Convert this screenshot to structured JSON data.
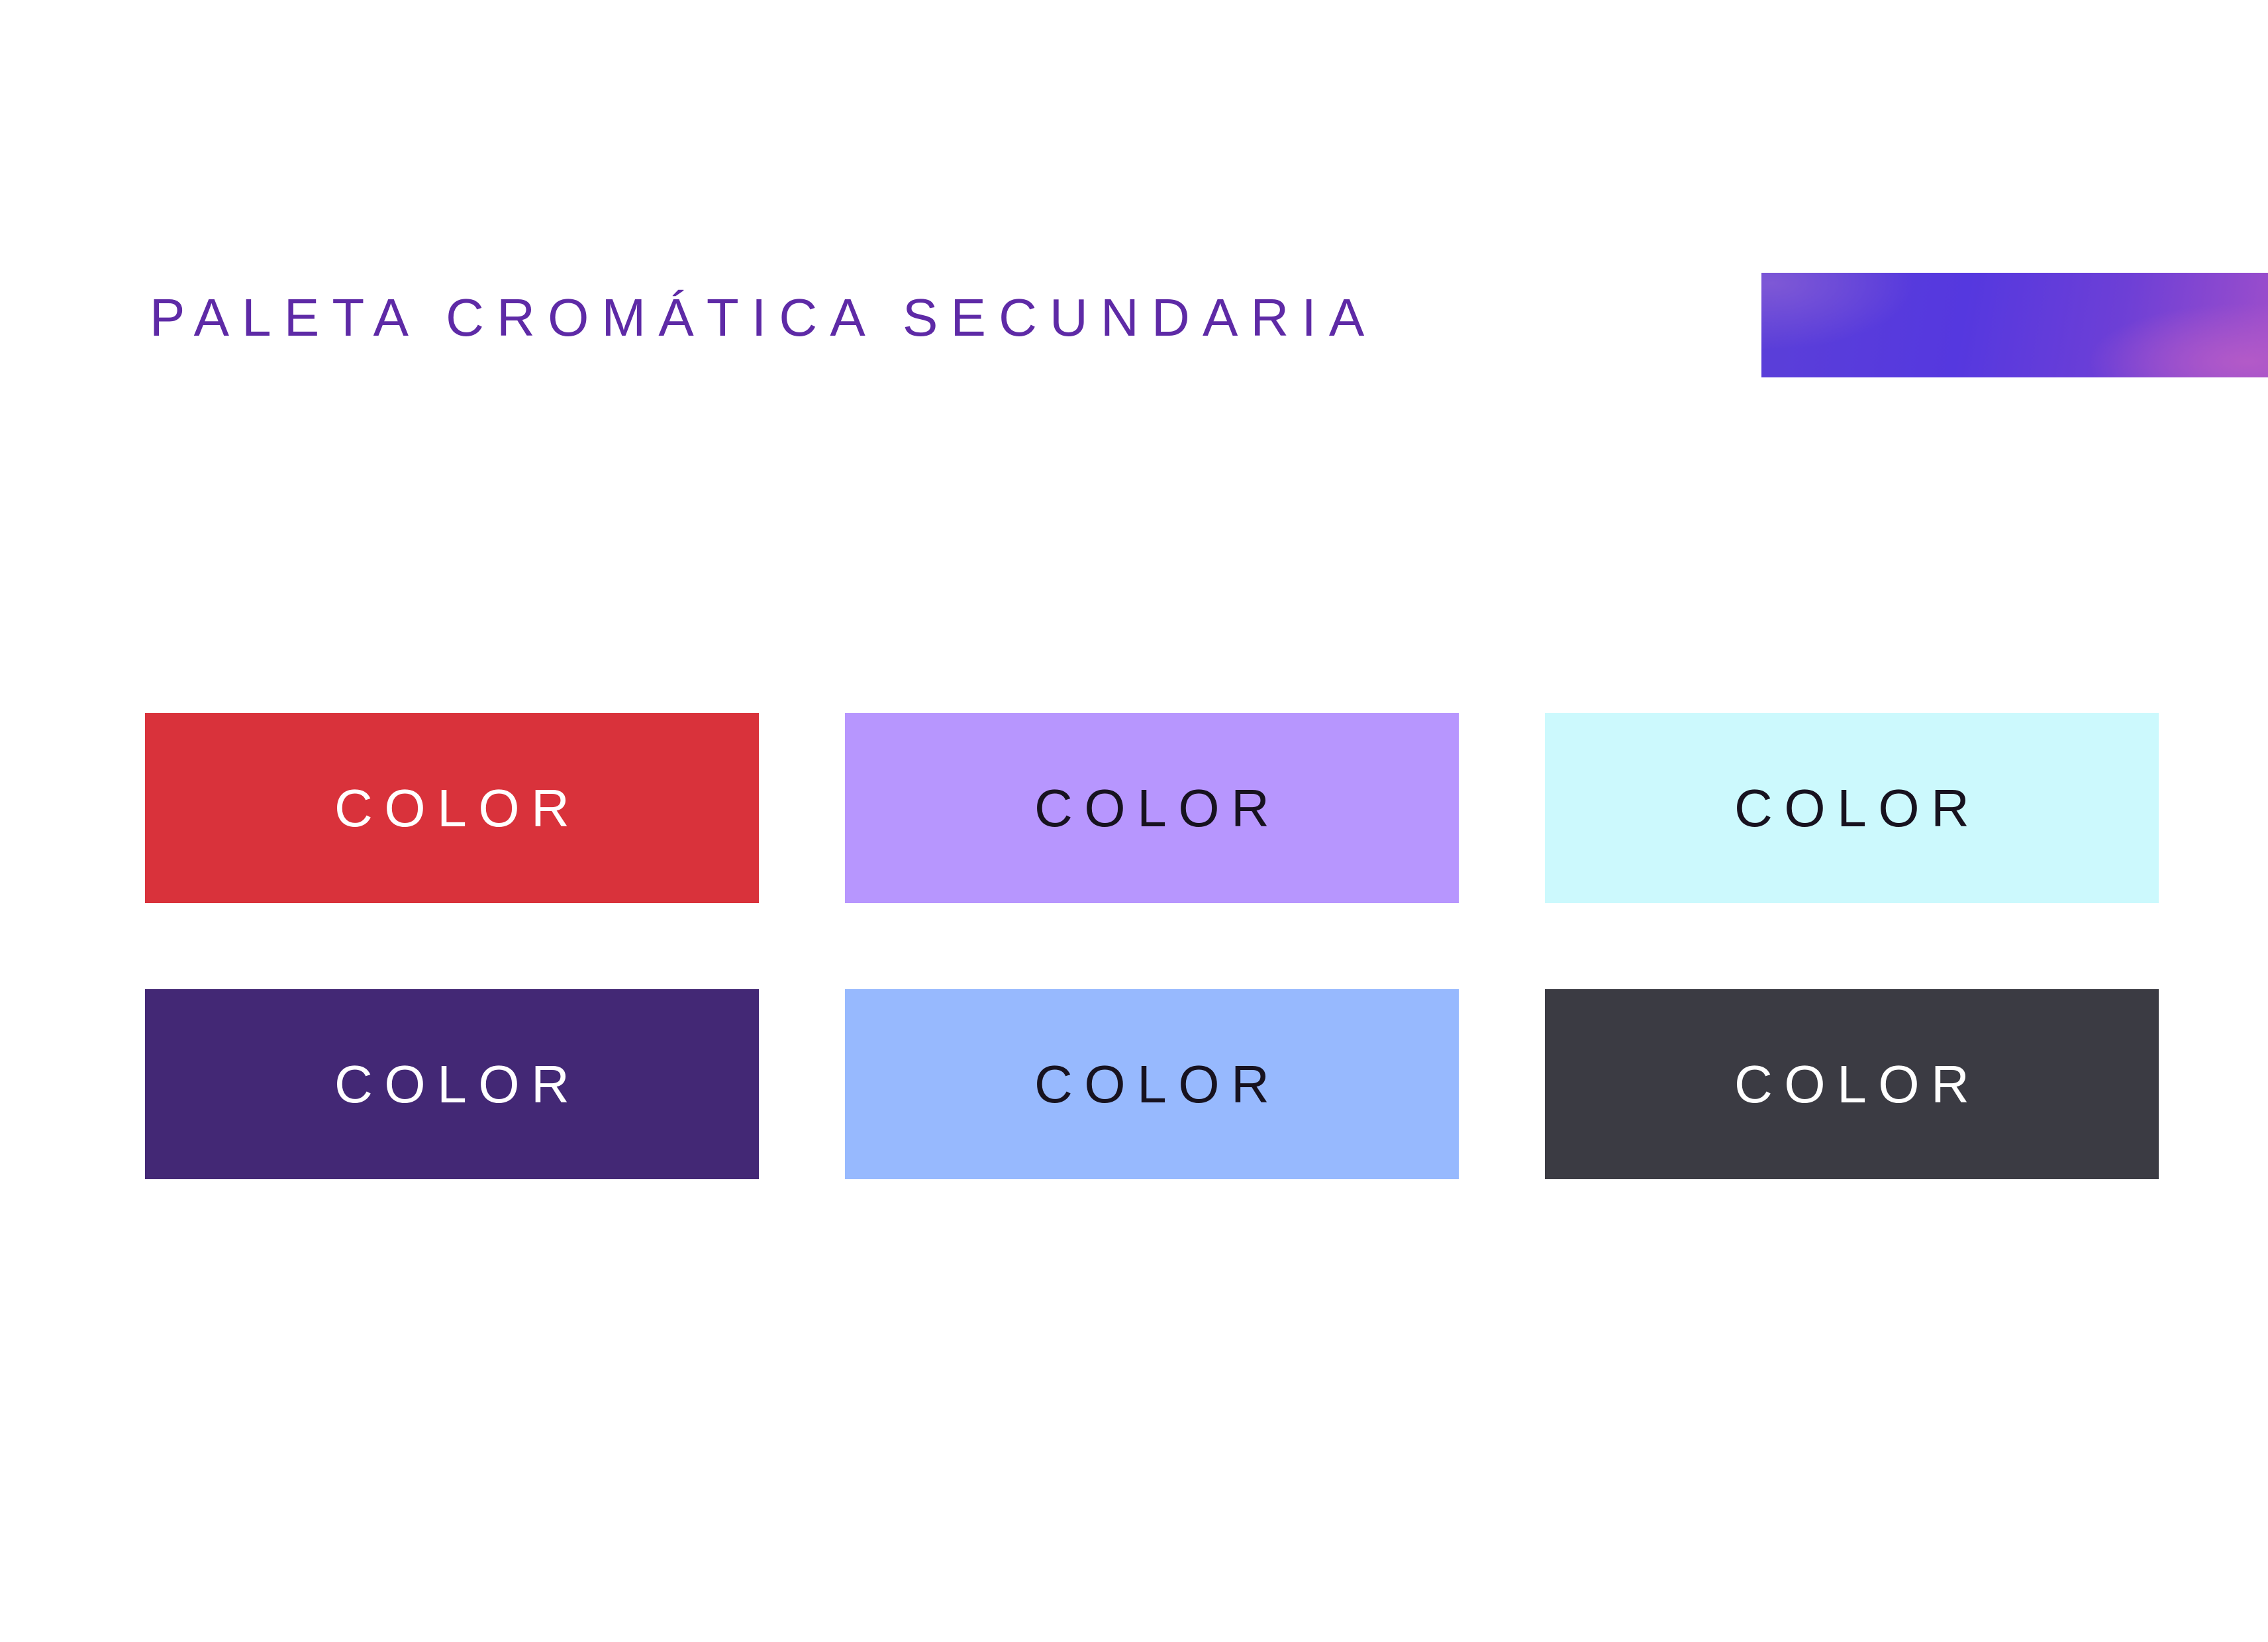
{
  "title": "PALETA CROMÁTICA SECUNDARIA",
  "title_color": "#5e2aa6",
  "accent_bar": {
    "colors": [
      "#5538df",
      "#b35ac8"
    ]
  },
  "swatches": [
    {
      "label": "COLOR",
      "color": "#d9323b",
      "text_color": "#ffffff"
    },
    {
      "label": "COLOR",
      "color": "#b796fe",
      "text_color": "#17121f"
    },
    {
      "label": "COLOR",
      "color": "#ccf9fd",
      "text_color": "#17121f"
    },
    {
      "label": "COLOR",
      "color": "#432875",
      "text_color": "#ffffff"
    },
    {
      "label": "COLOR",
      "color": "#97b9fe",
      "text_color": "#17121f"
    },
    {
      "label": "COLOR",
      "color": "#3b3b43",
      "text_color": "#ffffff"
    }
  ]
}
